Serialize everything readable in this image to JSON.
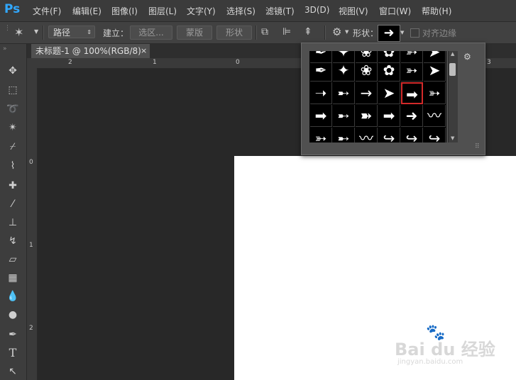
{
  "app": {
    "logo": "Ps"
  },
  "menubar": {
    "items": [
      "文件(F)",
      "编辑(E)",
      "图像(I)",
      "图层(L)",
      "文字(Y)",
      "选择(S)",
      "滤镜(T)",
      "3D(D)",
      "视图(V)",
      "窗口(W)",
      "帮助(H)"
    ]
  },
  "options": {
    "mode_value": "路径",
    "make_label": "建立：",
    "selection_label": "选区...",
    "mask_label": "蒙版",
    "shape_label": "形状",
    "shape_field_label": "形状：",
    "align_edges_label": "对齐边缘"
  },
  "document": {
    "tab_title": "未标题-1 @ 100%(RGB/8)",
    "tab_close": "×"
  },
  "rulers": {
    "horizontal": [
      "2",
      "1",
      "0",
      "3"
    ],
    "vertical": [
      "0",
      "1",
      "2"
    ]
  },
  "shape_picker": {
    "rows": [
      [
        "✒",
        "✦",
        "❀",
        "✿",
        "➳",
        "➤"
      ],
      [
        "➝",
        "➸",
        "→",
        "➤",
        "➡",
        "➳"
      ],
      [
        "➡",
        "➸",
        "➽",
        "➡",
        "➜",
        "〰"
      ],
      [
        "➳",
        "➸",
        "〰",
        "↪",
        "↪",
        "↪"
      ]
    ],
    "selected": "row2-col5"
  },
  "watermark": {
    "brand": "Bai du 经验",
    "url": "jingyan.baidu.com"
  },
  "colors": {
    "selection_highlight": "#d32a2a",
    "accent": "#31a8ff"
  }
}
